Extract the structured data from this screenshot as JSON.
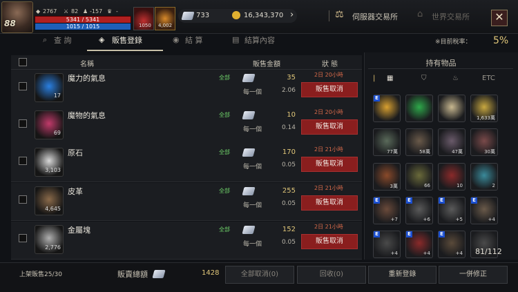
{
  "header": {
    "level": "88",
    "stat_power": "2767",
    "stat_attack": "82",
    "stat_defense": "-157",
    "stat_extra": "-",
    "hp_text": "5341 / 5341",
    "mp_text": "1015 / 1015",
    "potion_count": "1050",
    "gold_orb_count": "4,002",
    "diamond_count": "733",
    "gold_count": "16,343,370",
    "server_exchange": "伺服器交易所",
    "world_exchange": "世界交易所",
    "close_label": "✕"
  },
  "tabs": [
    {
      "label": "查 詢"
    },
    {
      "label": "販售登錄"
    },
    {
      "label": "結 算"
    },
    {
      "label": "結算內容"
    }
  ],
  "tax": {
    "label": "※目前稅率：",
    "value": "5%"
  },
  "table": {
    "headers": {
      "name": "名稱",
      "price": "販售金額",
      "status": "狀 態"
    },
    "rows": [
      {
        "name": "魔力的氣息",
        "qty": "17",
        "quality": "全部",
        "price": "35",
        "each_label": "每一個",
        "unit": "2.06",
        "timer": "2日 20小時",
        "cancel": "販售取消",
        "color": "#2a7fe0"
      },
      {
        "name": "魔物的氣息",
        "qty": "69",
        "quality": "全部",
        "price": "10",
        "each_label": "每一個",
        "unit": "0.14",
        "timer": "2日 20小時",
        "cancel": "販售取消",
        "color": "#c03a6a"
      },
      {
        "name": "原石",
        "qty": "3,103",
        "quality": "全部",
        "price": "170",
        "each_label": "每一個",
        "unit": "0.05",
        "timer": "2日 21小時",
        "cancel": "販售取消",
        "color": "#d8d8d8"
      },
      {
        "name": "皮革",
        "qty": "4,645",
        "quality": "全部",
        "price": "255",
        "each_label": "每一個",
        "unit": "0.05",
        "timer": "2日 21小時",
        "cancel": "販售取消",
        "color": "#8a6a4a"
      },
      {
        "name": "金屬塊",
        "qty": "2,776",
        "quality": "全部",
        "price": "152",
        "each_label": "每一個",
        "unit": "0.05",
        "timer": "2日 21小時",
        "cancel": "販售取消",
        "color": "#b0b0b0"
      }
    ]
  },
  "inventory": {
    "title": "持有物品",
    "filter_etc": "ETC",
    "count": "81/112",
    "cells": [
      {
        "value": "",
        "badge": "E",
        "color": "#d8a030"
      },
      {
        "value": "",
        "badge": "",
        "color": "#2ea84a"
      },
      {
        "value": "",
        "badge": "",
        "color": "#c8b890"
      },
      {
        "value": "1,633萬",
        "badge": "",
        "color": "#c8a840"
      },
      {
        "value": "77萬",
        "badge": "",
        "color": "#5a6a5a"
      },
      {
        "value": "58萬",
        "badge": "",
        "color": "#6a5a4a"
      },
      {
        "value": "47萬",
        "badge": "",
        "color": "#6a5a6a"
      },
      {
        "value": "30萬",
        "badge": "",
        "color": "#7a4a4a"
      },
      {
        "value": "3萬",
        "badge": "",
        "color": "#8a4a2a"
      },
      {
        "value": "66",
        "badge": "",
        "color": "#6a6a3a"
      },
      {
        "value": "10",
        "badge": "",
        "color": "#8a2a2a"
      },
      {
        "value": "2",
        "badge": "",
        "color": "#3a8a9a"
      },
      {
        "value": "+7",
        "badge": "E",
        "color": "#6a4a3a"
      },
      {
        "value": "+6",
        "badge": "E",
        "color": "#5a5a5a"
      },
      {
        "value": "+5",
        "badge": "E",
        "color": "#5a5a5a"
      },
      {
        "value": "+4",
        "badge": "E",
        "color": "#6a5a4a"
      },
      {
        "value": "+4",
        "badge": "E",
        "color": "#4a4a4a"
      },
      {
        "value": "+4",
        "badge": "E",
        "color": "#8a2a2a"
      },
      {
        "value": "+4",
        "badge": "E",
        "color": "#5a4a3a"
      },
      {
        "value": "",
        "badge": "",
        "color": "#4a4a4a"
      }
    ]
  },
  "footer": {
    "listed": "上架販售25/30",
    "total_label": "販賣總額",
    "total_value": "1428",
    "btn_cancel_all": "全部取消(0)",
    "btn_recover": "回收(0)",
    "btn_relist": "重新登錄",
    "btn_modify": "一併修正"
  }
}
